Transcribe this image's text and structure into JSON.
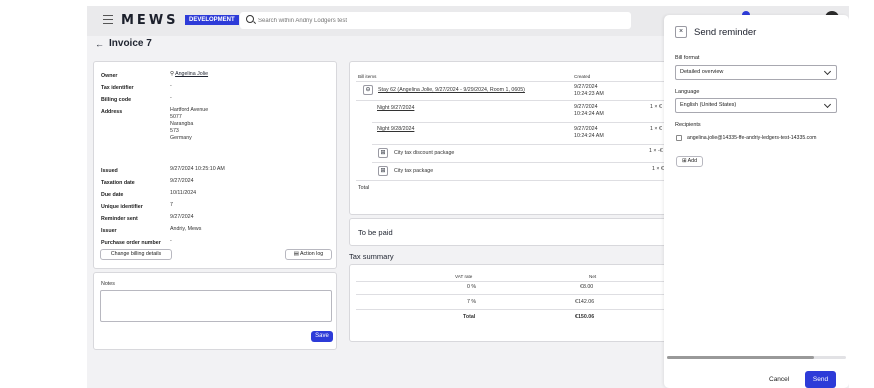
{
  "header": {
    "logo": "MEWS",
    "env_badge": "DEVELOPMENT",
    "search_placeholder": "Search within Andriy Lodgers test"
  },
  "page": {
    "back_arrow": "←",
    "title": "Invoice 7"
  },
  "details": {
    "owner_label": "Owner",
    "owner_value": "Angelina Jolie",
    "tax_id_label": "Tax identifier",
    "tax_id_value": "-",
    "billing_code_label": "Billing code",
    "billing_code_value": "-",
    "address_label": "Address",
    "address_lines": [
      "Hartford Avenue",
      "5077",
      "Narangba",
      "573",
      "Germany"
    ],
    "issued_label": "Issued",
    "issued_value": "9/27/2024 10:25:10 AM",
    "taxation_date_label": "Taxation date",
    "taxation_date_value": "9/27/2024",
    "due_date_label": "Due date",
    "due_date_value": "10/11/2024",
    "unique_id_label": "Unique identifier",
    "unique_id_value": "7",
    "reminder_label": "Reminder sent",
    "reminder_value": "9/27/2024",
    "issuer_label": "Issuer",
    "issuer_value": "Andriy, Mews",
    "po_label": "Purchase order number",
    "po_value": "-",
    "change_btn": "Change billing details",
    "action_log_btn": "Action log"
  },
  "notes": {
    "label": "Notes",
    "value": "",
    "save_btn": "Save"
  },
  "bill_items": {
    "col_items": "Bill items",
    "col_created": "Created",
    "rows": [
      {
        "name": "Stay 62 (Angelina Jolie, 9/27/2024 - 9/29/2024, Room 1, 0605)",
        "created": [
          "9/27/2024",
          "10:24:23 AM"
        ],
        "qty": ""
      },
      {
        "name": "Night 9/27/2024",
        "created": [
          "9/27/2024",
          "10:24:24 AM"
        ],
        "qty": "1 × €"
      },
      {
        "name": "Night 9/28/2024",
        "created": [
          "9/27/2024",
          "10:24:24 AM"
        ],
        "qty": "1 × €"
      },
      {
        "name": "City tax discount package",
        "created": [
          "",
          ""
        ],
        "qty": "1 × -€"
      },
      {
        "name": "City tax package",
        "created": [
          "",
          ""
        ],
        "qty": "1 × €"
      }
    ],
    "total_label": "Total"
  },
  "to_be_paid": "To be paid",
  "tax_summary": {
    "title": "Tax summary",
    "col_rate": "VAT rate",
    "col_net": "Net",
    "rows": [
      {
        "rate": "0 %",
        "net": "€8.00"
      },
      {
        "rate": "7 %",
        "net": "€142.06"
      }
    ],
    "total_label": "Total",
    "total_net": "€150.06"
  },
  "modal": {
    "close": "×",
    "title": "Send reminder",
    "bill_format_label": "Bill format",
    "bill_format_value": "Detailed overview",
    "language_label": "Language",
    "language_value": "English (United States)",
    "recipients_label": "Recipients",
    "recipient_email": "angelina.jolie@14335-ffe-andriy-ledgers-test-14335.com",
    "add_btn": "Add",
    "cancel_btn": "Cancel",
    "send_btn": "Send"
  }
}
